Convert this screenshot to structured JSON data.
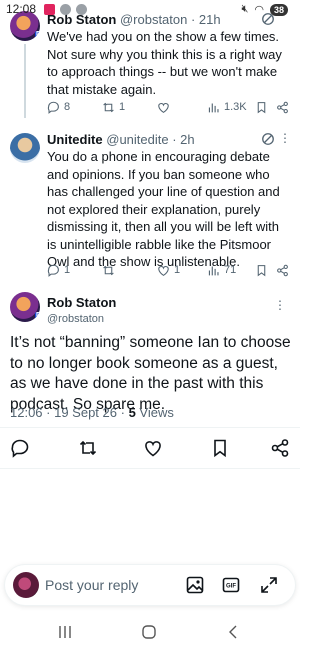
{
  "status_bar": {
    "time": "12:08",
    "battery": "38"
  },
  "replies": [
    {
      "name": "Rob Staton",
      "handle": "@robstaton",
      "time": "21h",
      "text": "We've had you on the show a few times. Not sure why you think this is a right way to approach things -- but we won't make that mistake again.",
      "replies_count": "8",
      "reposts_count": "1",
      "likes_count": "",
      "views": "1.3K"
    },
    {
      "name": "Unitedite",
      "handle": "@unitedite",
      "time": "2h",
      "text": "You do a phone in encouraging debate and opinions. If you ban someone who has challenged your line of question and not explored their explanation, purely dismissing it, then all you will be left with is unintelligible rabble like the Pitsmoor Owl and the show is unlistenable.",
      "replies_count": "1",
      "reposts_count": "",
      "likes_count": "1",
      "views": "71"
    }
  ],
  "main_tweet": {
    "name": "Rob Staton",
    "handle": "@robstaton",
    "text": "It’s not “banning” someone Ian to choose to no longer book someone as a guest, as we have done in the past with this podcast. So spare me.",
    "time": "12:06",
    "date": "19 Sept 26",
    "views_count": "5",
    "views_label": "Views"
  },
  "compose": {
    "placeholder": "Post your reply"
  },
  "icons": {
    "reply": "speech-bubble-icon",
    "repost": "repost-arrows-icon",
    "like": "heart-icon",
    "views": "bar-chart-icon",
    "bookmark": "bookmark-icon",
    "share": "share-nodes-icon",
    "grok": "grok-icon",
    "image": "image-icon",
    "gif": "gif-icon",
    "expand": "expand-icon"
  },
  "colors": {
    "text": "#0f1419",
    "secondary": "#536471",
    "divider": "#eff3f4"
  }
}
